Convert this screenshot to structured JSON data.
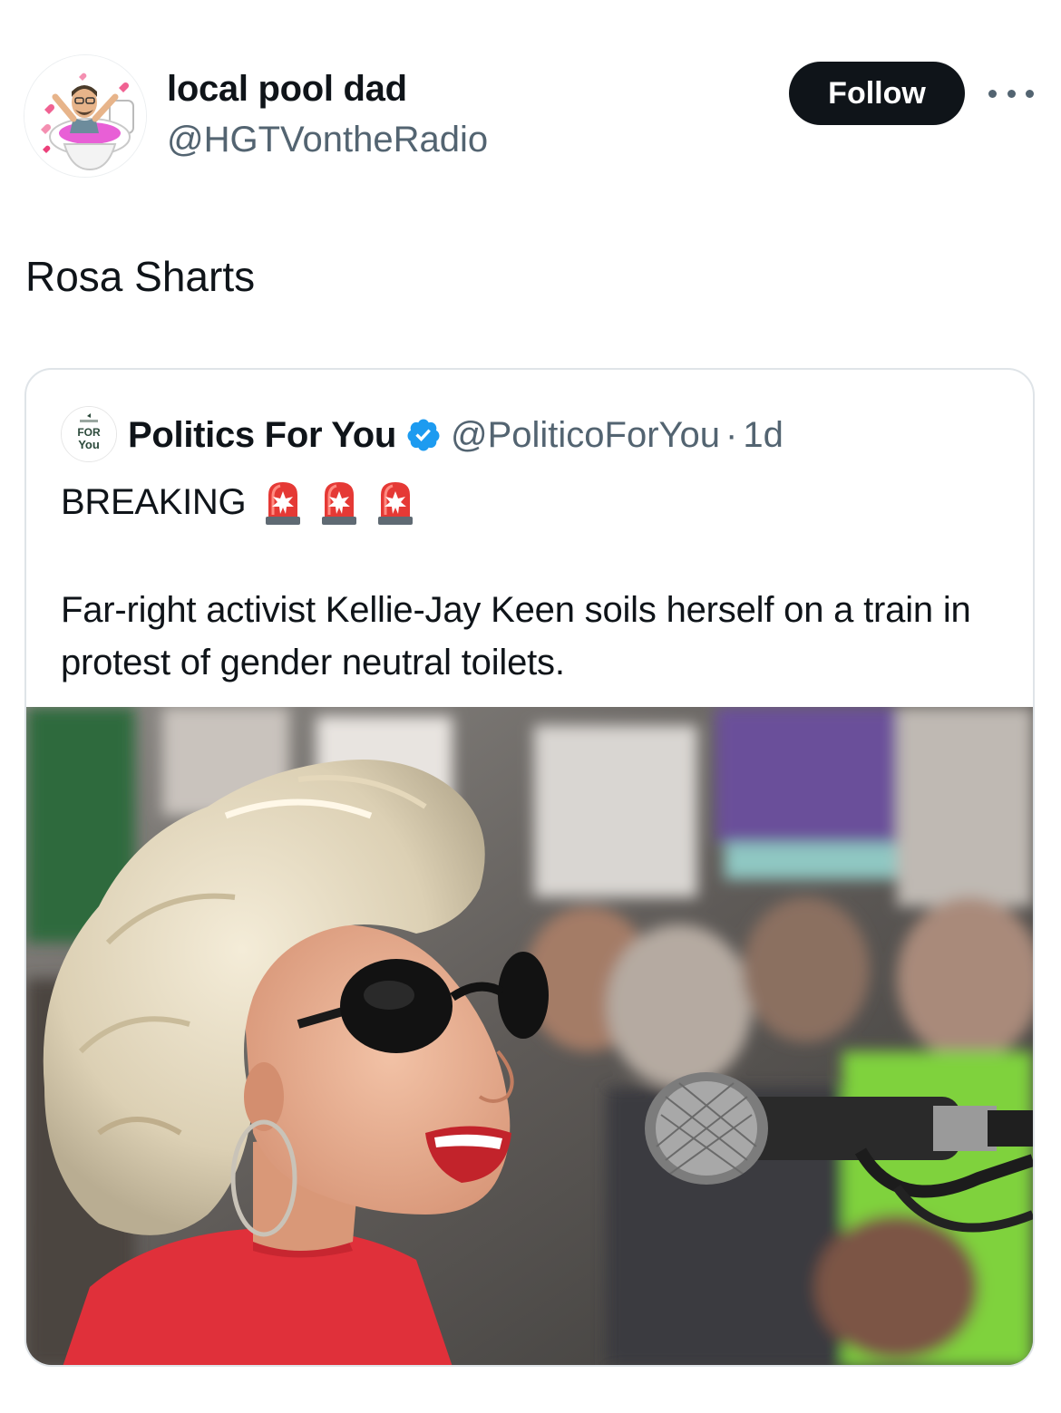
{
  "tweet": {
    "author": {
      "display_name": "local pool dad",
      "handle": "@HGTVontheRadio",
      "avatar_icon": "bitmoji-toilet-avatar-icon"
    },
    "follow_label": "Follow",
    "more_icon": "more-options-icon",
    "text": "Rosa Sharts"
  },
  "quote": {
    "author": {
      "display_name": "Politics For You",
      "handle": "@PoliticoForYou",
      "separator": "·",
      "time": "1d",
      "verified": true,
      "avatar_icon": "politics-for-you-logo-icon"
    },
    "headline": "BREAKING",
    "headline_emoji": [
      "police-siren-icon",
      "police-siren-icon",
      "police-siren-icon"
    ],
    "body": "Far-right activist Kellie-Jay Keen soils herself on a train in protest of gender neutral toilets.",
    "photo": "protest-speaker-photo"
  },
  "colors": {
    "text_primary": "#0f1419",
    "text_secondary": "#536471",
    "follow_bg": "#0f1419",
    "verified_blue": "#1d9bf0",
    "card_border": "#dfe4e8"
  }
}
